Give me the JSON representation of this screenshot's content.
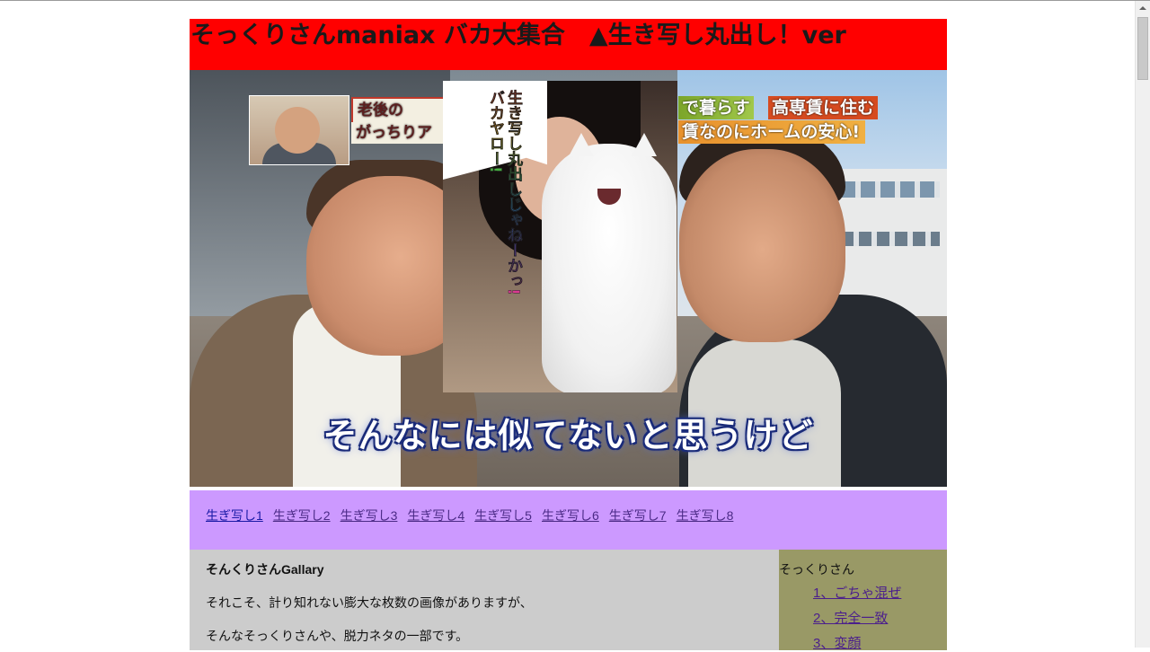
{
  "header": {
    "title": "そっくりさんmaniax バカ大集合　▲生き写し丸出し！ver"
  },
  "hero": {
    "tag_left_top": "老後の",
    "tag_left_bottom": "がっちりア",
    "tag_right_1": "で暮らす",
    "tag_right_2": "高専賃に住む",
    "tag_right_3": "賃なのにホームの安心!",
    "cat_caption": "生き写し丸出しじゃねーかっ! バカヤロー!",
    "subtitle": "そんなには似てないと思うけど"
  },
  "gallery_nav": {
    "links": [
      "生ぎ写し1",
      "生ぎ写し2",
      "生ぎ写し3",
      "生ぎ写し4",
      "生ぎ写し5",
      "生ぎ写し6",
      "生ぎ写し7",
      "生ぎ写し8"
    ]
  },
  "main": {
    "title": "そんくりさんGallary",
    "paragraphs": [
      "それこそ、計り知れない膨大な枚数の画像がありますが、",
      "そんなそっくりさんや、脱力ネタの一部です。"
    ]
  },
  "sidebar": {
    "title": "そっくりさん",
    "links": [
      "1、ごちゃ混ぜ",
      "2、完全一致",
      "3、変顔"
    ]
  },
  "colors": {
    "header_bg": "#ff0000",
    "nav_bg": "#cc99ff",
    "main_bg": "#cccccc",
    "side_bg": "#999966"
  }
}
